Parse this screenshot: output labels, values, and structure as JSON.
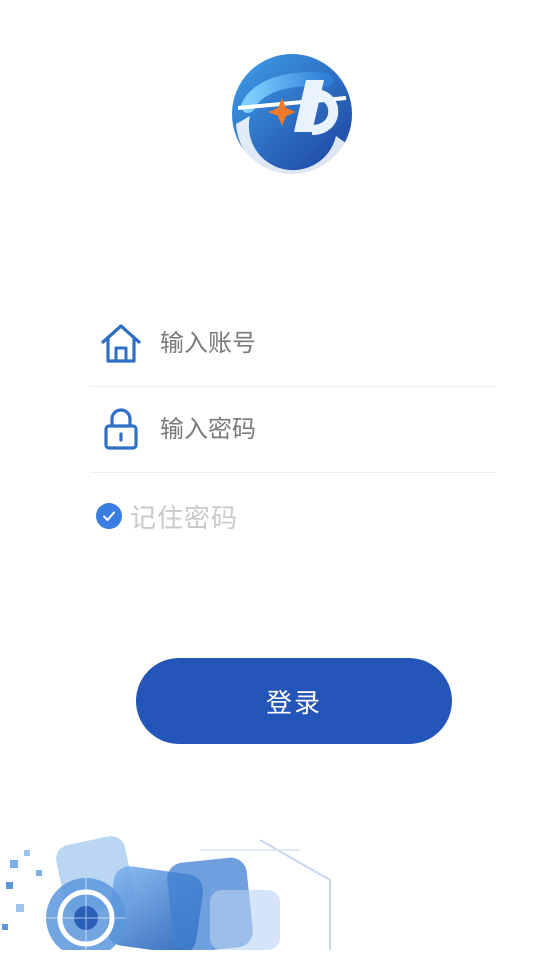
{
  "colors": {
    "brand_blue": "#2455b8",
    "accent_blue": "#3a7de0",
    "icon_blue": "#2f6fc6",
    "divider": "#ececec",
    "placeholder": "#7a7a7a",
    "remember_text": "#c9c9c9"
  },
  "logo": {
    "icon": "company-logo"
  },
  "form": {
    "account": {
      "icon": "home-icon",
      "placeholder": "输入账号",
      "value": ""
    },
    "password": {
      "icon": "lock-icon",
      "placeholder": "输入密码",
      "value": ""
    },
    "remember": {
      "icon": "check-icon",
      "label": "记住密码",
      "checked": true
    }
  },
  "login_button": {
    "label": "登录"
  },
  "decoration": {
    "icon": "tech-graphic"
  }
}
